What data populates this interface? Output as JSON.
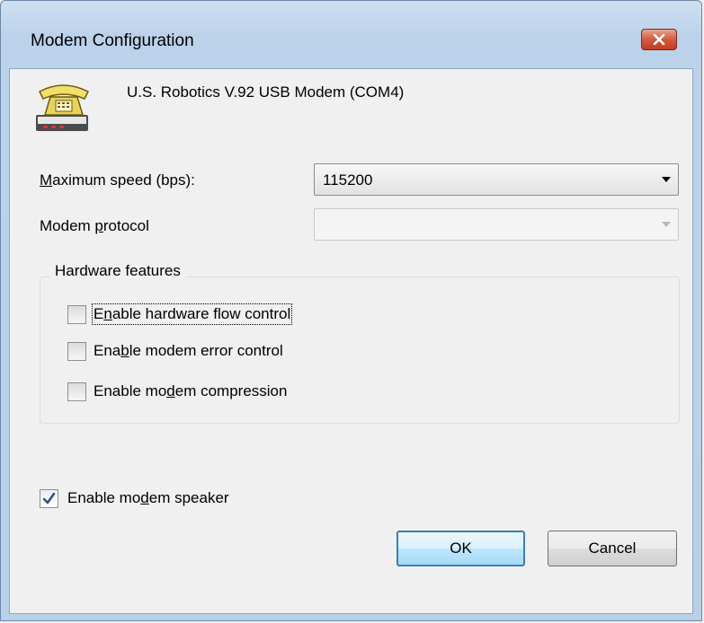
{
  "window": {
    "title": "Modem Configuration",
    "close_icon": "close-icon"
  },
  "device": {
    "icon": "telephone-modem-icon",
    "name": "U.S. Robotics V.92 USB Modem (COM4)"
  },
  "max_speed": {
    "label_pre": "",
    "label_key": "M",
    "label_post": "aximum speed (bps):",
    "value": "115200"
  },
  "protocol": {
    "label_pre": "Modem ",
    "label_key": "p",
    "label_post": "rotocol",
    "value": "",
    "enabled": false
  },
  "hardware": {
    "title": "Hardware features",
    "items": [
      {
        "pre": "E",
        "key": "n",
        "post": "able hardware flow control",
        "checked": false
      },
      {
        "pre": "Ena",
        "key": "b",
        "post": "le modem error control",
        "checked": false
      },
      {
        "pre": "Enable mo",
        "key": "d",
        "post": "em compression",
        "checked": false
      }
    ]
  },
  "speaker": {
    "pre": "Enable mo",
    "key": "d",
    "post": "em speaker",
    "checked": true
  },
  "buttons": {
    "ok": "OK",
    "cancel": "Cancel"
  },
  "colors": {
    "accent": "#3c7fb1",
    "close_red": "#c23c20"
  }
}
